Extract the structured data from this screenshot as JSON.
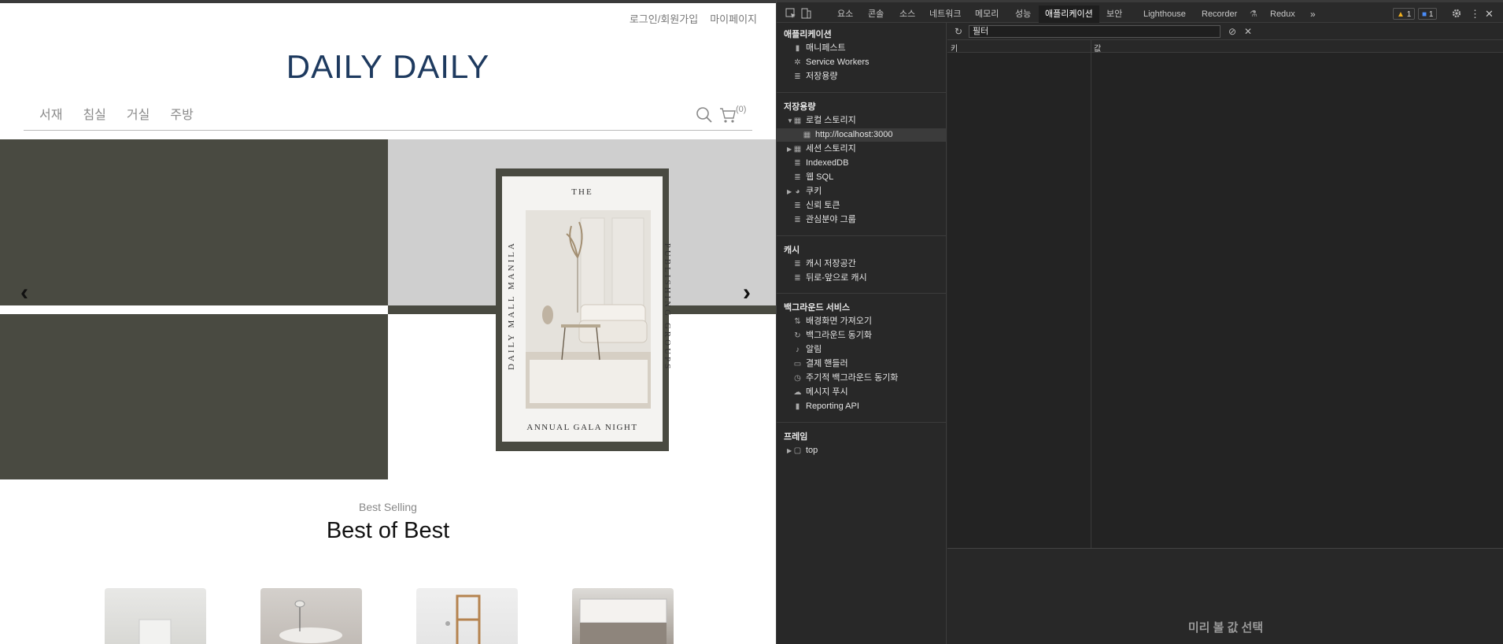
{
  "site": {
    "top_links": [
      "로그인/회원가입",
      "마이페이지"
    ],
    "logo": "DAILY DAILY",
    "categories": [
      "서재",
      "침실",
      "거실",
      "주방"
    ],
    "cart_count": "(0)",
    "slider": {
      "prev": "‹",
      "next": "›",
      "poster": {
        "top": "THE",
        "left": "DAILY MALL MANILA",
        "right": "PUBLISHING GROUPS",
        "bottom": "ANNUAL GALA NIGHT"
      }
    },
    "best": {
      "subtitle": "Best Selling",
      "title": "Best of Best"
    }
  },
  "devtools": {
    "tabs": [
      "요소",
      "콘솔",
      "소스",
      "네트워크",
      "메모리",
      "성능",
      "애플리케이션",
      "보안",
      "Lighthouse",
      "Recorder",
      "Redux"
    ],
    "active_tab": "애플리케이션",
    "warnings": "1",
    "messages": "1",
    "sidebar": {
      "application": {
        "heading": "애플리케이션",
        "items": [
          "매니페스트",
          "Service Workers",
          "저장용량"
        ]
      },
      "storage": {
        "heading": "저장용량",
        "local_storage": "로컬 스토리지",
        "local_origin": "http://localhost:3000",
        "session_storage": "세션 스토리지",
        "items": [
          "IndexedDB",
          "웹 SQL",
          "쿠키",
          "신뢰 토큰",
          "관심분야 그룹"
        ]
      },
      "cache": {
        "heading": "캐시",
        "items": [
          "캐시 저장공간",
          "뒤로-앞으로 캐시"
        ]
      },
      "background": {
        "heading": "백그라운드 서비스",
        "items": [
          "배경화면 가져오기",
          "백그라운드 동기화",
          "알림",
          "결제 핸들러",
          "주기적 백그라운드 동기화",
          "메시지 푸시",
          "Reporting API"
        ]
      },
      "frames": {
        "heading": "프레임",
        "items": [
          "top"
        ]
      }
    },
    "main": {
      "filter_value": "필터",
      "col_key": "키",
      "col_value": "값",
      "preview_text": "미리 볼 값 선택"
    }
  }
}
